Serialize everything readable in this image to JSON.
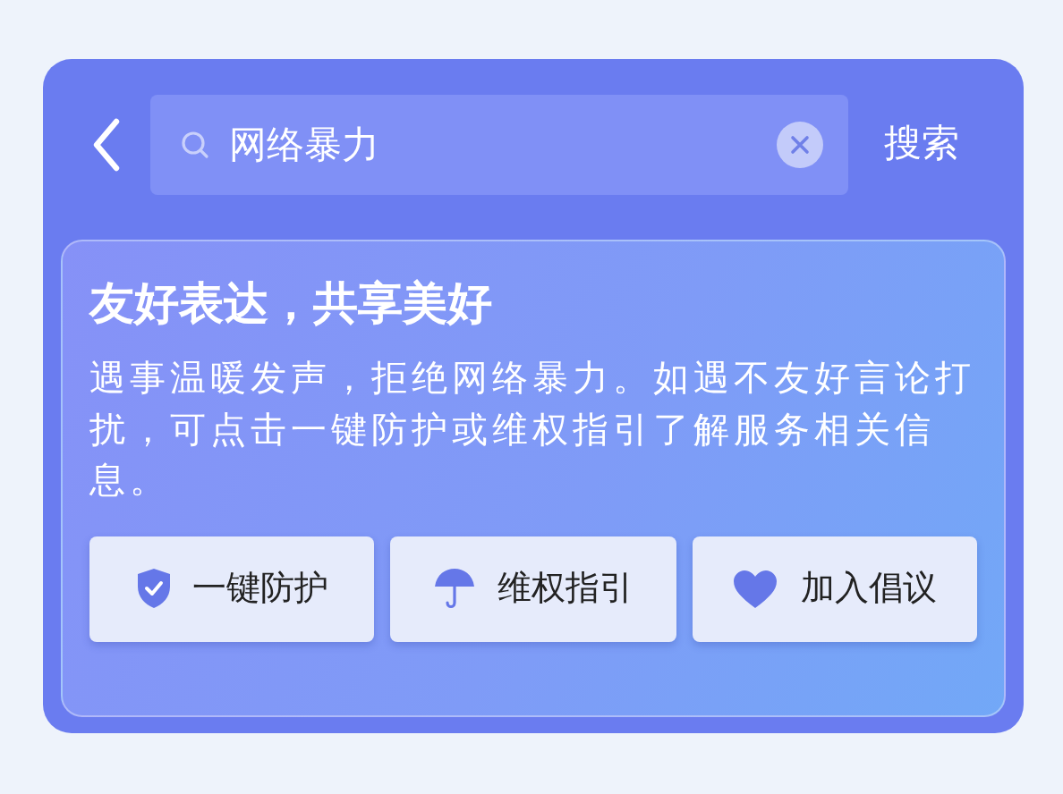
{
  "header": {
    "search": {
      "value": "网络暴力"
    },
    "search_button": "搜索"
  },
  "card": {
    "title": "友好表达，共享美好",
    "description": "遇事温暖发声，拒绝网络暴力。如遇不友好言论打扰，可点击一键防护或维权指引了解服务相关信息。",
    "buttons": [
      {
        "label": "一键防护",
        "kind": "shield"
      },
      {
        "label": "维权指引",
        "kind": "umbrella"
      },
      {
        "label": "加入倡议",
        "kind": "heart"
      }
    ]
  }
}
